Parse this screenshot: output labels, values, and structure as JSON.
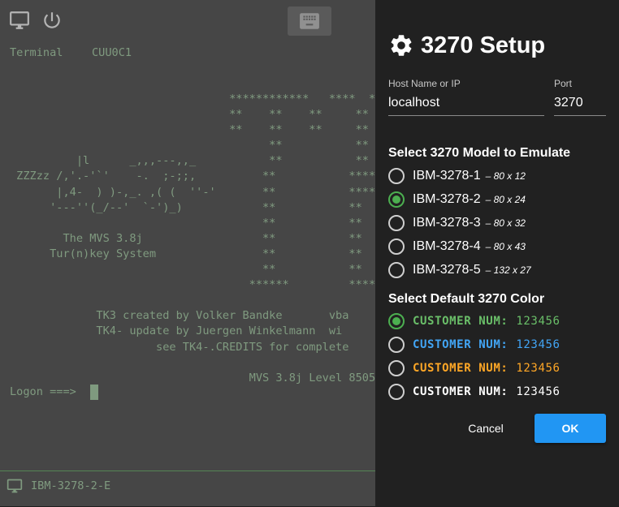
{
  "terminal": {
    "label": "Terminal",
    "id": "CUU0C1",
    "screen_lines": [
      "                                 ************   ****  ****",
      "                                 **    **    **     **    **",
      "                                 **    **    **     **    **",
      "                                       **           **  **",
      "          |l      _,,,---,,_           **           ** **",
      " ZZZzz /,'.-'`'    -.  ;-;;,          **           ****",
      "       |,4-  ) )-,_. ,( (  ''-'       **           *****",
      "      '---''(_/--'  `-')_)            **           **  **",
      "                                      **           **   **",
      "        The MVS 3.8j                  **           **    **",
      "      Tur(n)key System                **           **     **",
      "                                      **           **",
      "                                    ******         ****",
      "",
      "             TK3 created by Volker Bandke       vba",
      "             TK4- update by Juergen Winkelmann  wi",
      "                      see TK4-.CREDITS for complete",
      "",
      "                                    MVS 3.8j Level 8505"
    ],
    "logon_prompt": "Logon ===>",
    "status_model": "IBM-3278-2-E",
    "colors": {
      "text": "#7fb07f",
      "status_border": "#2f8a2f"
    },
    "icons": {
      "display": "monitor-icon",
      "power": "power-icon",
      "keyboard": "keyboard-icon",
      "status": "monitor-icon"
    }
  },
  "dialog": {
    "title": "3270 Setup",
    "title_icon": "gear-icon",
    "host": {
      "label": "Host Name or IP",
      "value": "localhost"
    },
    "port": {
      "label": "Port",
      "value": "3270"
    },
    "model_section": "Select 3270 Model to Emulate",
    "models": [
      {
        "name": "IBM-3278-1",
        "size": "– 80 x 12",
        "selected": false
      },
      {
        "name": "IBM-3278-2",
        "size": "– 80 x 24",
        "selected": true
      },
      {
        "name": "IBM-3278-3",
        "size": "– 80 x 32",
        "selected": false
      },
      {
        "name": "IBM-3278-4",
        "size": "– 80 x 43",
        "selected": false
      },
      {
        "name": "IBM-3278-5",
        "size": "– 132 x 27",
        "selected": false
      }
    ],
    "color_section": "Select Default 3270 Color",
    "color_options": [
      {
        "label": "CUSTOMER NUM:",
        "value": "123456",
        "color": "#6abf69",
        "selected": true
      },
      {
        "label": "CUSTOMER NUM:",
        "value": "123456",
        "color": "#42a5f5",
        "selected": false
      },
      {
        "label": "CUSTOMER NUM:",
        "value": "123456",
        "color": "#ffa726",
        "selected": false
      },
      {
        "label": "CUSTOMER NUM:",
        "value": "123456",
        "color": "#ffffff",
        "selected": false
      }
    ],
    "cancel_label": "Cancel",
    "ok_label": "OK",
    "colors": {
      "accent": "#2196f3",
      "radio_checked": "#4caf50",
      "background": "#212121"
    }
  }
}
